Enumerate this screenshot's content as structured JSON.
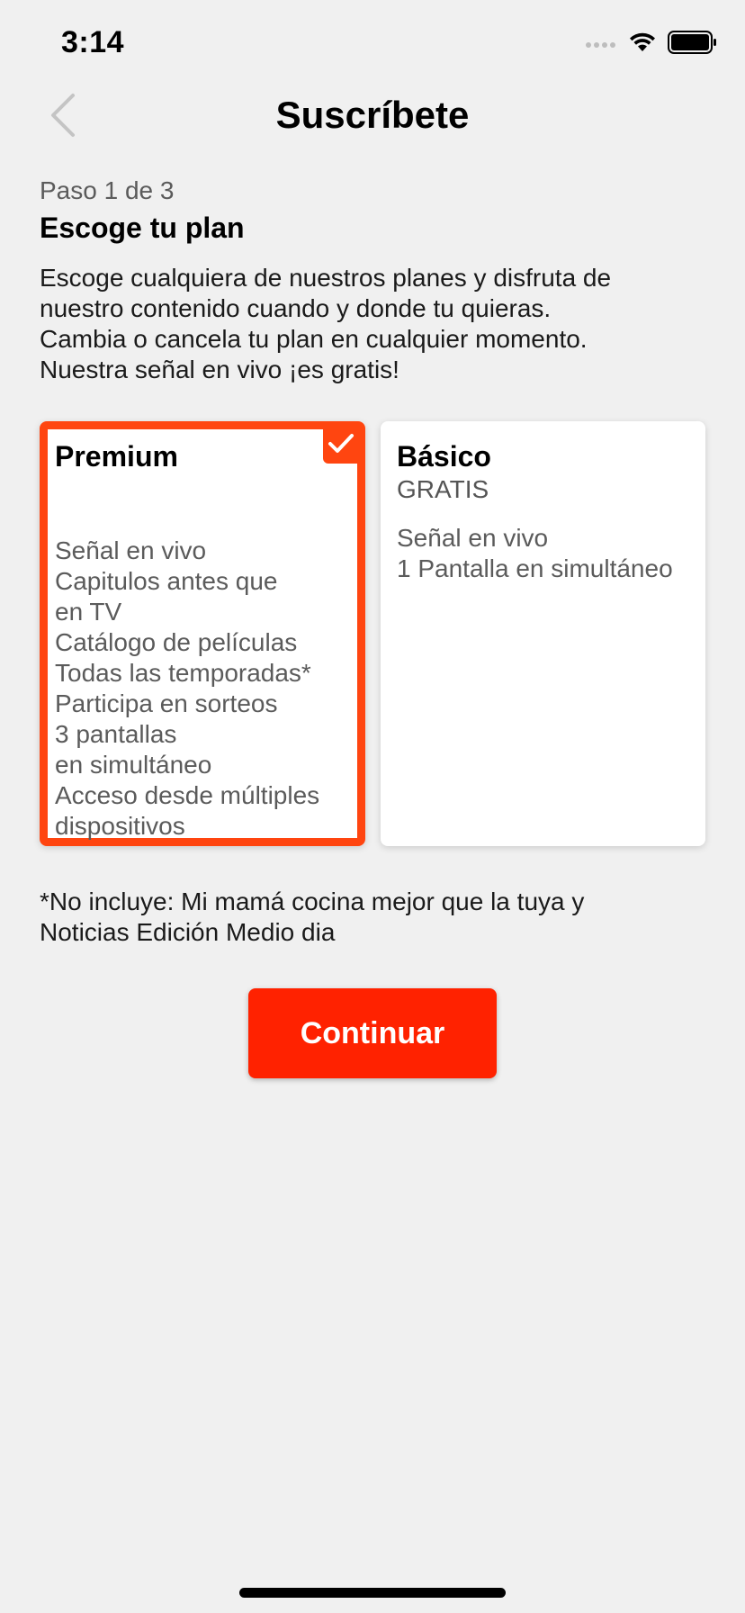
{
  "status_bar": {
    "time": "3:14"
  },
  "nav": {
    "title": "Suscríbete",
    "back_icon": "chevron-left-icon"
  },
  "step": {
    "label": "Paso 1 de 3",
    "title": "Escoge tu plan",
    "description_lines": [
      "Escoge cualquiera de nuestros planes y disfruta de",
      "nuestro contenido cuando y donde tu quieras.",
      "Cambia o cancela tu plan en cualquier momento.",
      "Nuestra señal en vivo ¡es gratis!"
    ]
  },
  "plans": [
    {
      "name": "Premium",
      "price": "",
      "selected": true,
      "features": [
        "Señal en vivo",
        "Capitulos antes que",
        "en TV",
        "Catálogo de películas",
        "Todas las temporadas*",
        "Participa en sorteos",
        "3 pantallas",
        "en simultáneo",
        "Acceso desde múltiples",
        "dispositivos"
      ]
    },
    {
      "name": "Básico",
      "price": "GRATIS",
      "selected": false,
      "features": [
        "Señal en vivo",
        "1 Pantalla en simultáneo"
      ]
    }
  ],
  "footnote_lines": [
    "*No incluye: Mi mamá cocina mejor que la tuya y",
    "Noticias Edición Medio dia"
  ],
  "continue_label": "Continuar",
  "colors": {
    "accent": "#ff4510",
    "button": "#ff2200",
    "background": "#f0f0f0"
  }
}
